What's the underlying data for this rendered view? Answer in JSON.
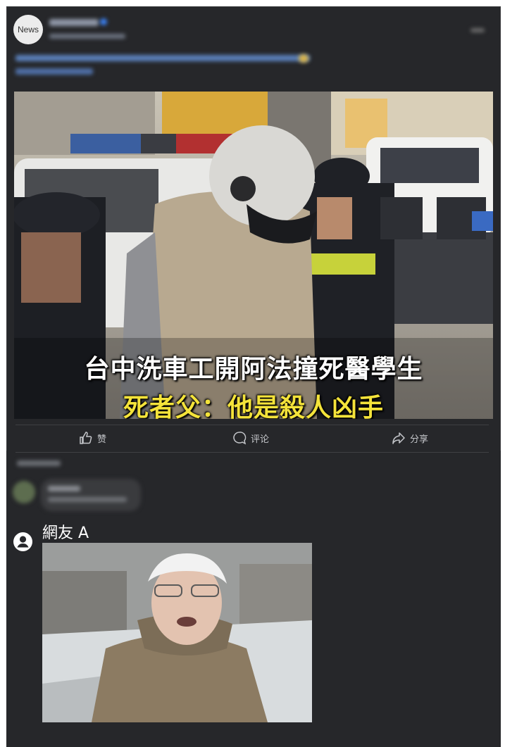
{
  "post": {
    "avatar_text": "News",
    "headline_line1": "台中洗車工開阿法撞死醫學生",
    "headline_line2": "死者父：他是殺人凶手"
  },
  "actions": {
    "like": "赞",
    "comment": "评论",
    "share": "分享"
  },
  "reply": {
    "username": "網友 A"
  },
  "colors": {
    "card_bg": "#26272a",
    "headline_white": "#ffffff",
    "headline_yellow": "#f4e33a"
  }
}
